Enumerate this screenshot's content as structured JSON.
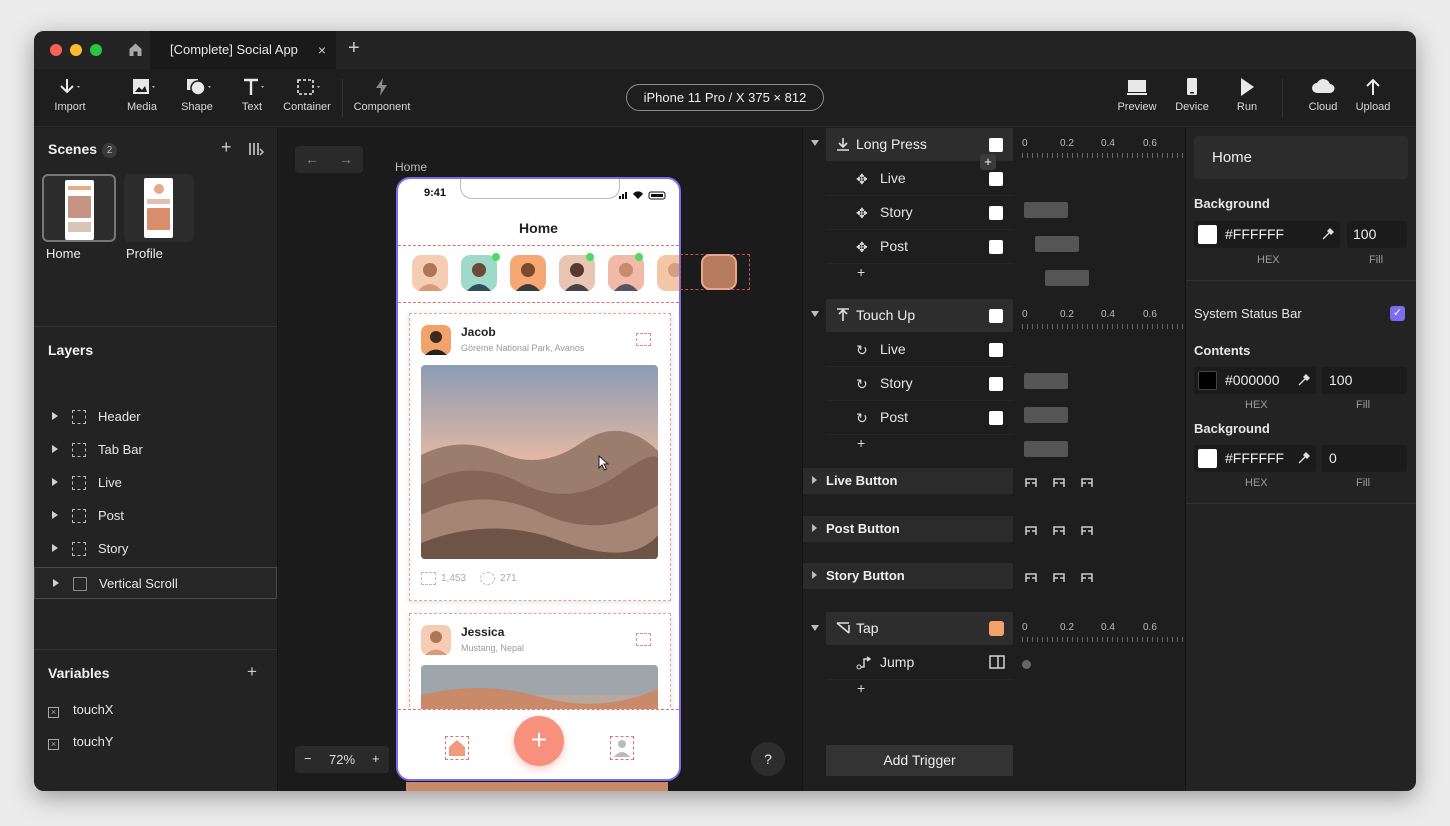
{
  "window": {
    "tab_title": "[Complete] Social App",
    "tab_close": "×",
    "new_tab": "+"
  },
  "toolbar": {
    "import": "Import",
    "media": "Media",
    "shape": "Shape",
    "text": "Text",
    "container": "Container",
    "component": "Component",
    "device_selector": "iPhone 11 Pro / X  375 × 812",
    "preview": "Preview",
    "device": "Device",
    "run": "Run",
    "cloud": "Cloud",
    "upload": "Upload"
  },
  "scenes": {
    "title": "Scenes",
    "count": "2",
    "items": [
      {
        "label": "Home"
      },
      {
        "label": "Profile"
      }
    ]
  },
  "layers": {
    "title": "Layers",
    "items": [
      "Header",
      "Tab Bar",
      "Live",
      "Post",
      "Story",
      "Vertical Scroll"
    ]
  },
  "variables": {
    "title": "Variables",
    "items": [
      "touchX",
      "touchY"
    ]
  },
  "canvas": {
    "frame_label": "Home",
    "zoom": "72%",
    "zoom_minus": "−",
    "zoom_plus": "+",
    "help": "?"
  },
  "phone": {
    "time": "9:41",
    "header": "Home",
    "posts": [
      {
        "name": "Jacob",
        "location": "Göreme National Park, Avanos",
        "likes": "1,453",
        "comments": "271"
      },
      {
        "name": "Jessica",
        "location": "Mustang, Nepal"
      }
    ],
    "fab": "+"
  },
  "interactions": {
    "ruler_ticks": [
      "0",
      "0.2",
      "0.4",
      "0.6"
    ],
    "triggers": [
      {
        "label": "Long Press",
        "rows": [
          "Live",
          "Story",
          "Post"
        ]
      },
      {
        "label": "Touch Up",
        "rows": [
          "Live",
          "Story",
          "Post"
        ]
      }
    ],
    "groups": [
      "Live Button",
      "Post Button",
      "Story Button"
    ],
    "tap": {
      "label": "Tap",
      "row": "Jump"
    },
    "add": "+",
    "add_trigger": "Add Trigger"
  },
  "properties": {
    "scene_name": "Home",
    "background_label": "Background",
    "background_hex": "#FFFFFF",
    "background_fill": "100",
    "hex_label": "HEX",
    "fill_label": "Fill",
    "status_bar_label": "System Status Bar",
    "contents_label": "Contents",
    "contents_hex": "#000000",
    "contents_fill": "100",
    "status_bg_label": "Background",
    "status_bg_hex": "#FFFFFF",
    "status_bg_fill": "0"
  },
  "colors": {
    "accent": "#7b6cf0",
    "fab": "#f7917d",
    "online": "#4cd964"
  }
}
